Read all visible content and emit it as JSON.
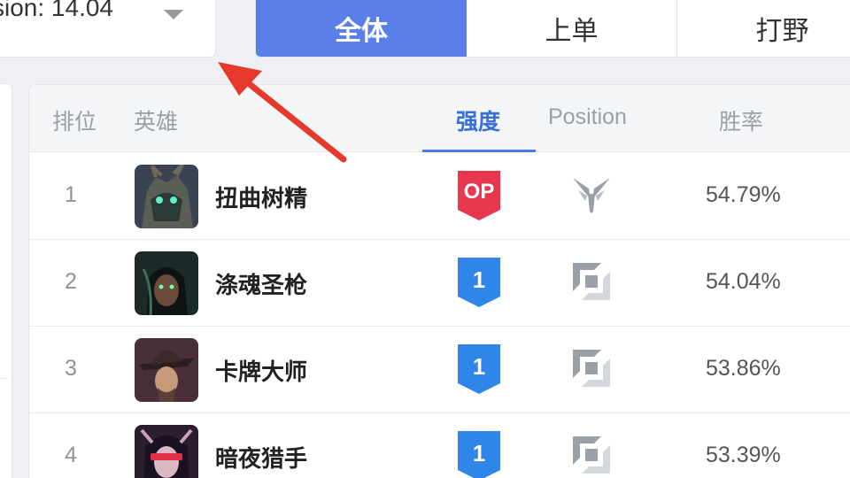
{
  "version_select": {
    "text": "sion: 14.04"
  },
  "tabs": [
    {
      "label": "全体",
      "active": true
    },
    {
      "label": "上单",
      "active": false
    },
    {
      "label": "打野",
      "active": false
    }
  ],
  "table": {
    "headers": {
      "rank": "排位",
      "hero": "英雄",
      "tier": "强度",
      "position": "Position",
      "winrate": "胜率"
    },
    "rows": [
      {
        "rank": "1",
        "hero": "扭曲树精",
        "tier": "OP",
        "winrate": "54.79%",
        "avatar_icon": "maokai-portrait",
        "position_icon": "jungle-icon"
      },
      {
        "rank": "2",
        "hero": "涤魂圣枪",
        "tier": "1",
        "winrate": "54.04%",
        "avatar_icon": "senna-portrait",
        "position_icon": "top-lane-icon"
      },
      {
        "rank": "3",
        "hero": "卡牌大师",
        "tier": "1",
        "winrate": "53.86%",
        "avatar_icon": "twisted-fate-portrait",
        "position_icon": "top-lane-icon"
      },
      {
        "rank": "4",
        "hero": "暗夜猎手",
        "tier": "1",
        "winrate": "53.39%",
        "avatar_icon": "vayne-portrait",
        "position_icon": "top-lane-icon"
      }
    ]
  },
  "colors": {
    "accent": "#5b7fe8",
    "op_badge": "#e8384f",
    "tier1_badge": "#2f86e8",
    "annotation_arrow": "#e5392b"
  }
}
